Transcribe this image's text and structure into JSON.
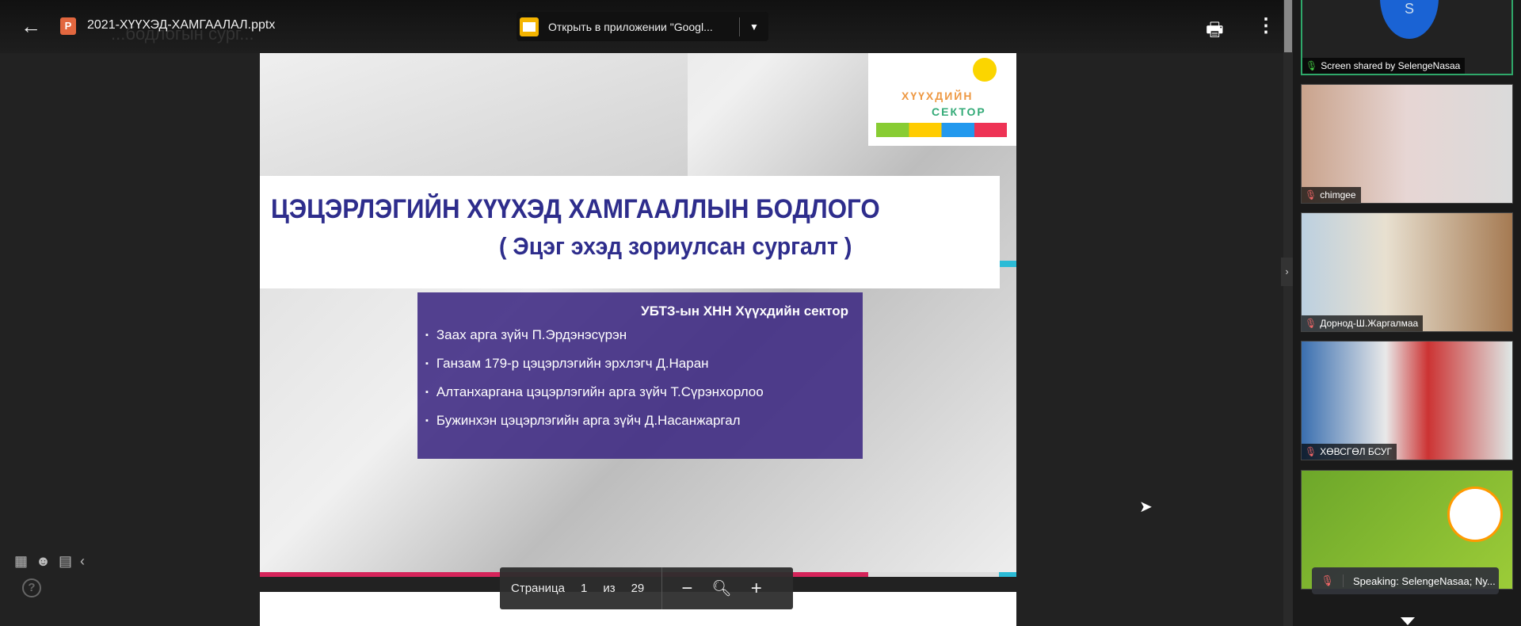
{
  "viewer": {
    "file_name": "2021-ХҮҮХЭД-ХАМГААЛАЛ.pptx",
    "ghost_text": "...бодлогын сург...",
    "open_button_label": "Открыть в приложении \"Googl...",
    "page_label": "Страница",
    "current_page": "1",
    "of_label": "из",
    "total_pages": "29"
  },
  "slide": {
    "title": "ЦЭЦЭРЛЭГИЙН ХҮҮХЭД ХАМГААЛЛЫН БОДЛОГО",
    "subtitle": "( Эцэг  эхэд зориулсан сургалт )",
    "logo_text_1": "ХҮҮХДИЙН",
    "logo_text_2": "СЕКТОР",
    "org": "УБТЗ-ын ХНН  Хүүхдийн сектор",
    "items": [
      "Заах арга зүйч П.Эрдэнэсүрэн",
      "Ганзам 179-р цэцэрлэгийн эрхлэгч Д.Наран",
      "Алтанхаргана  цэцэрлэгийн арга зүйч Т.Сүрэнхорлоо",
      "Бужинхэн цэцэрлэгийн арга зүйч Д.Насанжаргал"
    ]
  },
  "participants": [
    {
      "name": "Screen shared by SelengeNasaa",
      "avatar_letter": "S"
    },
    {
      "name": "chimgee"
    },
    {
      "name": "Дорнод-Ш.Жаргалмаа"
    },
    {
      "name": "ХӨВСГӨЛ БСУГ"
    },
    {
      "name": ""
    }
  ],
  "speaking": "Speaking: SelengeNasaa; Ny..."
}
